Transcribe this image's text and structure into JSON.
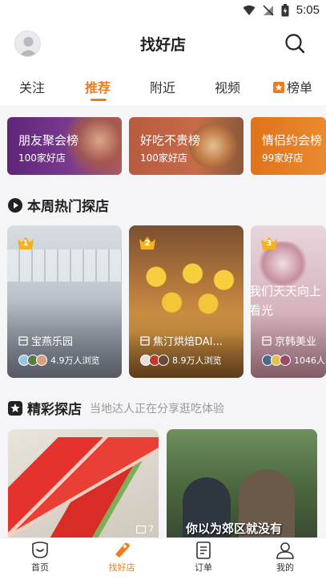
{
  "status": {
    "time": "5:05"
  },
  "header": {
    "title": "找好店"
  },
  "tabs": [
    {
      "label": "关注"
    },
    {
      "label": "推荐"
    },
    {
      "label": "附近"
    },
    {
      "label": "视频"
    },
    {
      "label": "榜单"
    }
  ],
  "active_tab": "推荐",
  "ranks": [
    {
      "title": "朋友聚会榜",
      "sub": "100家好店"
    },
    {
      "title": "好吃不贵榜",
      "sub": "100家好店"
    },
    {
      "title": "情侣约会榜",
      "sub": "99家好店"
    }
  ],
  "hot_section": {
    "title": "本周热门探店"
  },
  "explore": [
    {
      "rank": "1",
      "name": "宝燕乐园",
      "views": "4.9万人浏览"
    },
    {
      "rank": "2",
      "name": "焦汀烘焙DAI...",
      "views": "8.9万人浏览"
    },
    {
      "rank": "3",
      "name": "京韩美业",
      "views": "1046人浏览"
    }
  ],
  "explore_overlay_text": "我们天天向上 看光",
  "feed_section": {
    "title": "精彩探店",
    "sub": "当地达人正在分享逛吃体验"
  },
  "feed": [
    {
      "count": "7"
    },
    {
      "caption": "你以为郊区就没有"
    }
  ],
  "bottom_nav": [
    {
      "label": "首页"
    },
    {
      "label": "找好店"
    },
    {
      "label": "订单"
    },
    {
      "label": "我的"
    }
  ],
  "colors": {
    "accent": "#f07b1d",
    "rank1": "#6c2a85",
    "rank2": "#c96b4a",
    "rank3": "#e47a1e"
  }
}
